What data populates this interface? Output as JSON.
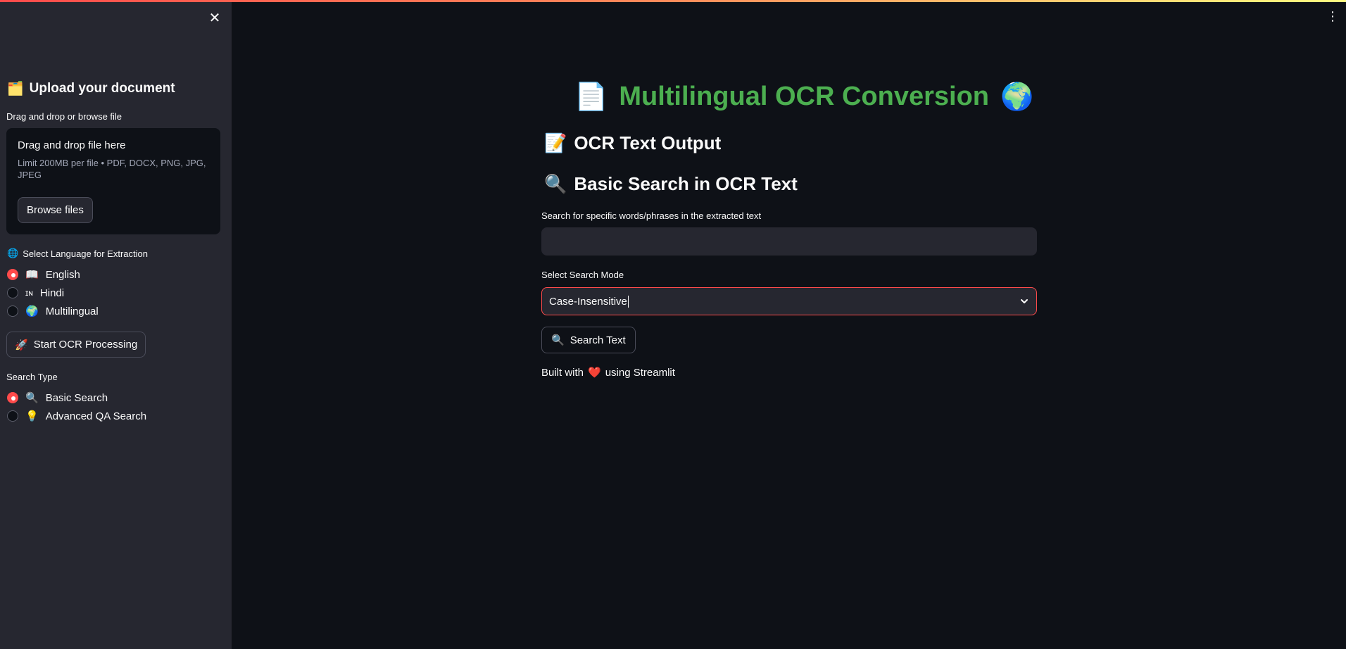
{
  "sidebar": {
    "close_icon": "✕",
    "upload_heading": "Upload your document",
    "upload_heading_icon": "🗂️",
    "upload_label": "Drag and drop or browse file",
    "dropzone_title": "Drag and drop file here",
    "dropzone_limit": "Limit 200MB per file • PDF, DOCX, PNG, JPG, JPEG",
    "browse_button": "Browse files",
    "language_label": "Select Language for Extraction",
    "language_label_icon": "🌐",
    "languages": [
      {
        "icon": "📖",
        "label": "English",
        "selected": true
      },
      {
        "icon": "ɪɴ",
        "label": "Hindi",
        "selected": false
      },
      {
        "icon": "🌍",
        "label": "Multilingual",
        "selected": false
      }
    ],
    "ocr_button_icon": "🚀",
    "ocr_button": "Start OCR Processing",
    "search_type_label": "Search Type",
    "search_types": [
      {
        "icon": "🔍",
        "label": "Basic Search",
        "selected": true
      },
      {
        "icon": "💡",
        "label": "Advanced QA Search",
        "selected": false
      }
    ]
  },
  "main": {
    "menu_icon": "⋮",
    "title_left_icon": "📄",
    "title": "Multilingual OCR Conversion",
    "title_right_icon": "🌍",
    "ocr_output_icon": "📝",
    "ocr_output_heading": "OCR Text Output",
    "basic_search_icon": "🔍",
    "basic_search_heading": "Basic Search in OCR Text",
    "search_input_label": "Search for specific words/phrases in the extracted text",
    "search_input_value": "",
    "search_mode_label": "Select Search Mode",
    "search_mode_value": "Case-Insensitive",
    "search_button_icon": "🔍",
    "search_button": "Search Text",
    "footer_prefix": "Built with",
    "footer_heart": "❤️",
    "footer_suffix": "using Streamlit"
  },
  "colors": {
    "background": "#0e1117",
    "sidebar": "#262730",
    "accent": "#ff4b4b",
    "title": "#4caf50"
  }
}
